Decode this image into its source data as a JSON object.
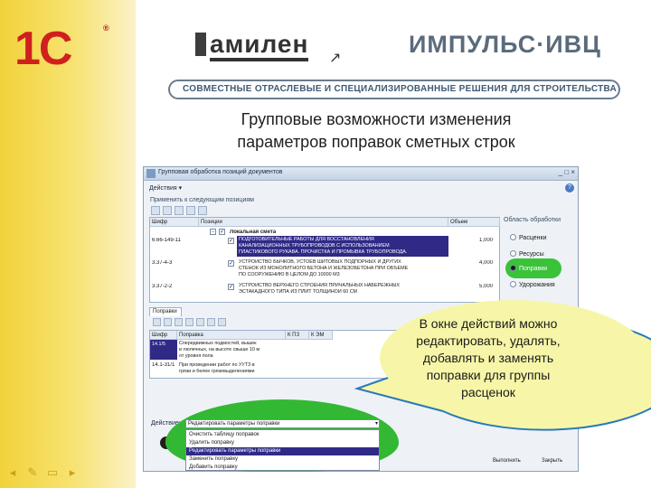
{
  "brand": {
    "logo_1c": "1С",
    "logo_1c_reg": "®",
    "logo_amilen": "амилен",
    "logo_impuls": "ИМПУЛЬС·ИВЦ",
    "banner": "СОВМЕСТНЫЕ ОТРАСЛЕВЫЕ И СПЕЦИАЛИЗИРОВАННЫЕ РЕШЕНИЯ ДЛЯ СТРОИТЕЛЬСТВА"
  },
  "slide": {
    "title_line1": "Групповые возможности изменения",
    "title_line2": "параметров поправок сметных строк"
  },
  "window": {
    "title": "Групповая обработка позиций документов",
    "controls": "_ □ ×",
    "actions_menu": "Действия ▾",
    "help": "?",
    "apply_label": "Применить к следующим позициям",
    "columns": [
      "Шифр",
      "Позиции",
      "Объем"
    ],
    "rows": [
      {
        "code": "",
        "text": "Локальная смета",
        "volume": ""
      },
      {
        "code": "6.66-149-11",
        "text_lines": [
          "ПОДГОТОВИТЕЛЬНЫЕ РАБОТЫ ДЛЯ ВОССТАНОВЛЕНИЯ",
          "КАНАЛИЗАЦИОННЫХ ТРУБОПРОВОДОВ С ИСПОЛЬЗОВАНИЕМ",
          "ПЛАСТИКОВОГО РУКАВА. ПРОЧИСТКА И ПРОМЫВКА ТРУБОПРОВОДА."
        ],
        "volume": "1,000"
      },
      {
        "code": "3.37-4-3",
        "text_lines": [
          "УСТРОЙСТВО БЫЧКОВ, УСТОЕВ ШИТОВЫХ ПОДПОРНЫХ И ДРУГИХ",
          "СТЕНОК ИЗ МОНОЛИТНОГО БЕТОНА И ЖЕЛЕЗОБЕТОНА ПРИ ОБЪЕМЕ",
          "ПО СООРУЖЕНИЮ В ЦЕЛОМ ДО 10000 М3"
        ],
        "volume": "4,000"
      },
      {
        "code": "3.37-2-2",
        "text_lines": [
          "УСТРОЙСТВО ВЕРХНЕГО СТРОЕНИЯ ПРИЧАЛЬНЫХ НАБЕРЕЖНЫХ",
          "ЭСТАКАДНОГО ТИПА ИЗ ПЛИТ ТОЛЩИНОЙ 60 СМ"
        ],
        "volume": "5,000"
      }
    ],
    "options_title": "Область обработки",
    "options": [
      "Расценки",
      "Ресурсы",
      "Поправки",
      "Удорожания"
    ],
    "lower_tab": "Поправки",
    "lower_columns": [
      "Шифр",
      "Поправка",
      "К ПЗ",
      "К ЭМ"
    ],
    "lower_rows": [
      {
        "code": "14.1/5",
        "text_lines": [
          "Спередвижных подмостей, вышек",
          "и люлечных, на высоте свыше 10 м",
          "от уровня пола"
        ]
      },
      {
        "code": "14.1-31/1",
        "text_lines": [
          "При проведении работ по УУТЗ в",
          "грязи и белее грязевыделениями"
        ]
      }
    ],
    "action_label": "Действие:",
    "info": "i",
    "run_button": "Выполнить",
    "close_button": "Закрыть"
  },
  "dropdown": {
    "selected": "Редактировать параметры поправки",
    "arrow": "▾",
    "items": [
      "Очистить таблицу поправок",
      "Удалить поправку",
      "Редактировать параметры поправки",
      "Заменить поправку",
      "Добавить поправку"
    ],
    "selected_index": 2
  },
  "callout": {
    "lines": [
      "В окне действий можно",
      "редактировать, удалять,",
      "добавлять и заменять",
      "поправки для группы",
      "расценок"
    ]
  },
  "nav": {
    "icons": [
      "◂",
      "✎",
      "▭",
      "▸"
    ]
  },
  "colors": {
    "yellow": "#f2d23a",
    "accent_red": "#d0201e",
    "selection": "#2f2a86",
    "green_highlight": "#33b833",
    "callout_fill": "#f7f6a8"
  }
}
